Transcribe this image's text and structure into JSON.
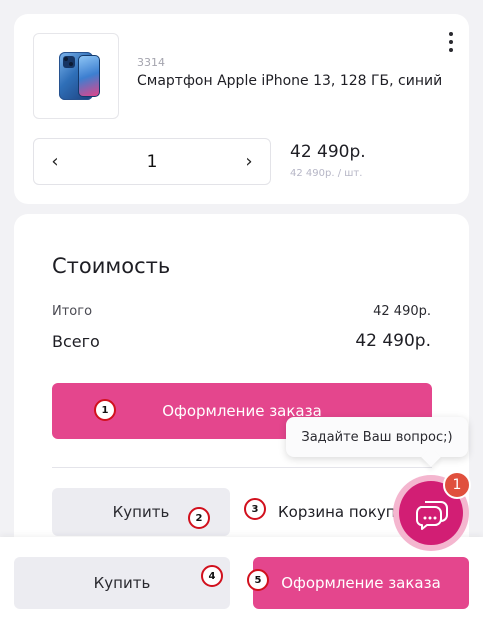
{
  "product": {
    "sku": "3314",
    "name": "Смартфон Apple iPhone 13, 128 ГБ, синий",
    "quantity": "1",
    "decrement_icon": "‹",
    "increment_icon": "›",
    "price": "42 490р.",
    "unit_price": "42 490р. / шт."
  },
  "cost": {
    "title": "Стоимость",
    "subtotal_label": "Итого",
    "subtotal_value": "42 490р.",
    "total_label": "Всего",
    "total_value": "42 490р.",
    "checkout_label": "Оформление заказа",
    "buy_label": "Купить",
    "cart_link": "Корзина покупок"
  },
  "bottom_bar": {
    "buy_label": "Купить",
    "checkout_label": "Оформление заказа"
  },
  "chat": {
    "tooltip": "Задайте Ваш вопрос;)",
    "unread_count": "1"
  },
  "markers": [
    "1",
    "2",
    "3",
    "4",
    "5"
  ],
  "colors": {
    "accent": "#e4468d",
    "chat": "#d21e74",
    "marker_border": "#d1101d"
  }
}
